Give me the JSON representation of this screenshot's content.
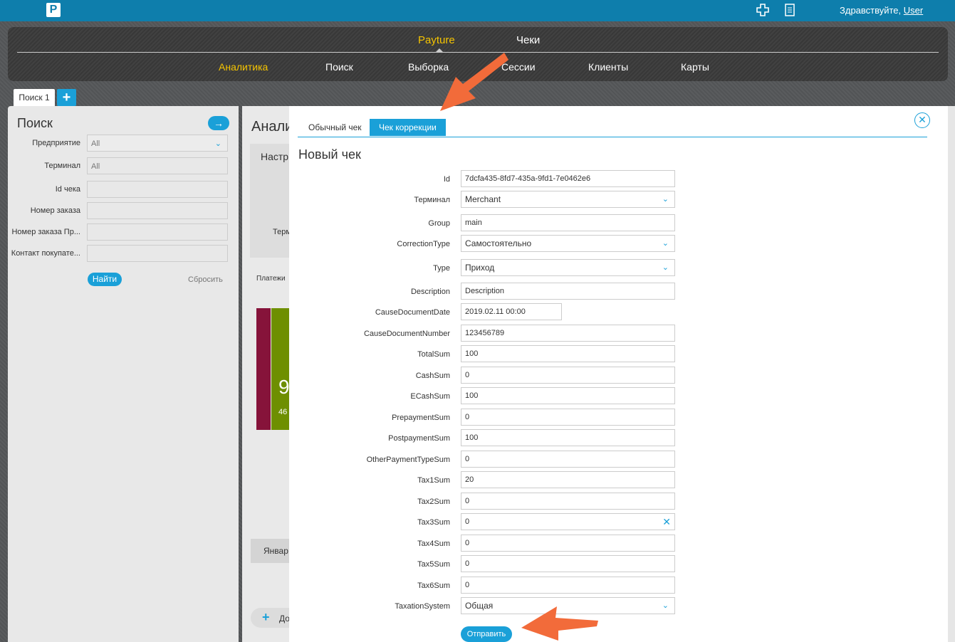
{
  "header": {
    "logo": "P",
    "greeting_prefix": "Здравствуйте,",
    "user": "User"
  },
  "nav": {
    "top": [
      {
        "label": "Payture",
        "color": "#f5c400",
        "active": true
      },
      {
        "label": "Чеки",
        "color": "#ffffff",
        "active": false
      }
    ],
    "sub": [
      {
        "label": "Аналитика",
        "active": true
      },
      {
        "label": "Поиск"
      },
      {
        "label": "Выборка"
      },
      {
        "label": "Сессии"
      },
      {
        "label": "Клиенты"
      },
      {
        "label": "Карты"
      }
    ]
  },
  "tabs": {
    "first": "Поиск 1",
    "add": "+"
  },
  "search_panel": {
    "title": "Поиск",
    "go": "→",
    "fields": [
      {
        "label": "Предприятие",
        "value": "All",
        "select": true
      },
      {
        "label": "Терминал",
        "value": "All"
      },
      {
        "label": "Id чека",
        "value": ""
      },
      {
        "label": "Номер заказа",
        "value": ""
      },
      {
        "label": "Номер заказа Пр...",
        "value": ""
      },
      {
        "label": "Контакт покупате...",
        "value": ""
      }
    ],
    "find": "Найти",
    "reset": "Сбросить"
  },
  "middle": {
    "title": "Анали",
    "box_title": "Настр",
    "box_term": "Терми",
    "payments": "Платежи",
    "big": "9",
    "small": "46",
    "month": "Январ",
    "add": "До"
  },
  "modal": {
    "tab_regular": "Обычный чек",
    "tab_correction": "Чек коррекции",
    "title": "Новый чек",
    "close": "✕",
    "fields": [
      {
        "label": "Id",
        "value": "7dcfa435-8fd7-435a-9fd1-7e0462e6"
      },
      {
        "label": "Терминал",
        "value": "Merchant",
        "select": true
      },
      {
        "label": "Group",
        "value": "main"
      },
      {
        "label": "CorrectionType",
        "value": "Самостоятельно",
        "select": true
      },
      {
        "label": "Type",
        "value": "Приход",
        "select": true
      },
      {
        "label": "Description",
        "value": "Description"
      },
      {
        "label": "CauseDocumentDate",
        "value": "2019.02.11 00:00",
        "short": true
      },
      {
        "label": "CauseDocumentNumber",
        "value": "123456789"
      },
      {
        "label": "TotalSum",
        "value": "100"
      },
      {
        "label": "CashSum",
        "value": "0"
      },
      {
        "label": "ECashSum",
        "value": "100"
      },
      {
        "label": "PrepaymentSum",
        "value": "0"
      },
      {
        "label": "PostpaymentSum",
        "value": "100"
      },
      {
        "label": "OtherPaymentTypeSum",
        "value": "0"
      },
      {
        "label": "Tax1Sum",
        "value": "20"
      },
      {
        "label": "Tax2Sum",
        "value": "0"
      },
      {
        "label": "Tax3Sum",
        "value": "0",
        "clear": true
      },
      {
        "label": "Tax4Sum",
        "value": "0"
      },
      {
        "label": "Tax5Sum",
        "value": "0"
      },
      {
        "label": "Tax6Sum",
        "value": "0"
      },
      {
        "label": "TaxationSystem",
        "value": "Общая",
        "select": true
      }
    ],
    "submit": "Отправить"
  },
  "colors": {
    "accent": "#1aa0d8",
    "brand": "#0e7eac",
    "arrow": "#f26b3a",
    "active_nav": "#f5c400"
  }
}
